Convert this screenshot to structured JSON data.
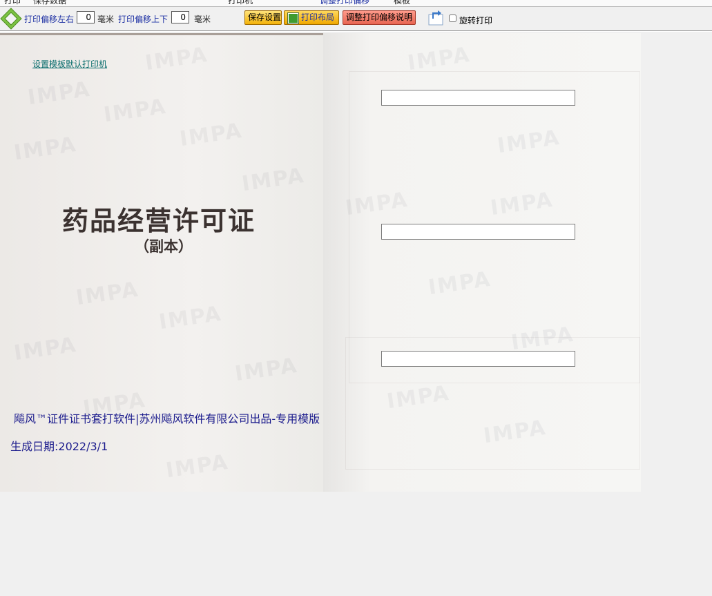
{
  "menu_strip": {
    "items": [
      "打印",
      "保存数据",
      "打印机",
      "调整打印偏移",
      "模板"
    ]
  },
  "toolbar": {
    "offset_lr_label": "打印偏移左右",
    "offset_lr_value": "0",
    "offset_ud_label": "打印偏移上下",
    "offset_ud_value": "0",
    "unit_label": "毫米",
    "save_label": "保存设置",
    "layout_label": "打印布局",
    "offset_help_label": "调整打印偏移说明",
    "rotate_label": "旋转打印",
    "rotate_checked": false
  },
  "document": {
    "set_default_printer_link": "设置模板默认打印机",
    "license_title": "药品经营许可证",
    "license_subtitle": "（副本）",
    "credit_text": "飚风™证件证书套打软件|苏州飚风软件有限公司出品-专用模版",
    "generated_date": "生成日期:2022/3/1",
    "watermark_text": "IMPA",
    "fields": [
      {
        "name": "field-1",
        "value": ""
      },
      {
        "name": "field-2",
        "value": ""
      },
      {
        "name": "field-3",
        "value": ""
      }
    ]
  },
  "colors": {
    "toolbar_label": "#1c2fa3",
    "credit_text": "#1a1a8c",
    "link": "#0a6d6d",
    "nav_icon_green": "#7cc242"
  }
}
